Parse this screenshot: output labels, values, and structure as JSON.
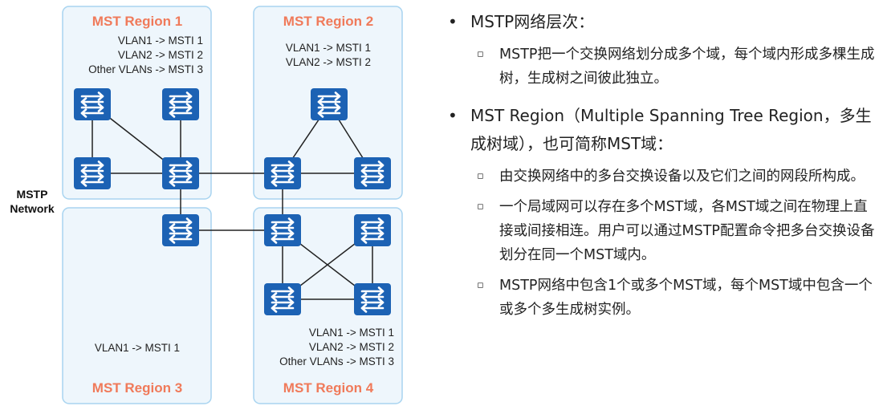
{
  "colors": {
    "region_fill": "#eef6fc",
    "region_border": "#a8d4f0",
    "region_title": "#f07a5a",
    "switch_fill": "#1c62b4",
    "switch_arrow": "#ffffff",
    "link": "#222222"
  },
  "diagram": {
    "network_label_line1": "MSTP",
    "network_label_line2": "Network",
    "switch_icon": "switch-icon",
    "regions": [
      {
        "title": "MST Region 1",
        "mappings": [
          "VLAN1 -> MSTI 1",
          "VLAN2 -> MSTI 2",
          "Other VLANs -> MSTI 3"
        ]
      },
      {
        "title": "MST Region 2",
        "mappings": [
          "VLAN1 -> MSTI 1",
          "VLAN2 -> MSTI 2"
        ]
      },
      {
        "title": "MST Region 3",
        "mappings": [
          "VLAN1 -> MSTI 1"
        ]
      },
      {
        "title": "MST Region 4",
        "mappings": [
          "VLAN1 -> MSTI 1",
          "VLAN2 -> MSTI 2",
          "Other VLANs -> MSTI 3"
        ]
      }
    ]
  },
  "notes": {
    "items": [
      {
        "text": "MSTP网络层次：",
        "subitems": [
          "MSTP把一个交换网络划分成多个域，每个域内形成多棵生成树，生成树之间彼此独立。"
        ]
      },
      {
        "text": "MST Region（Multiple Spanning Tree Region，多生成树域），也可简称MST域：",
        "subitems": [
          "由交换网络中的多台交换设备以及它们之间的网段所构成。",
          "一个局域网可以存在多个MST域，各MST域之间在物理上直接或间接相连。用户可以通过MSTP配置命令把多台交换设备划分在同一个MST域内。",
          "MSTP网络中包含1个或多个MST域，每个MST域中包含一个或多个多生成树实例。"
        ]
      }
    ]
  }
}
